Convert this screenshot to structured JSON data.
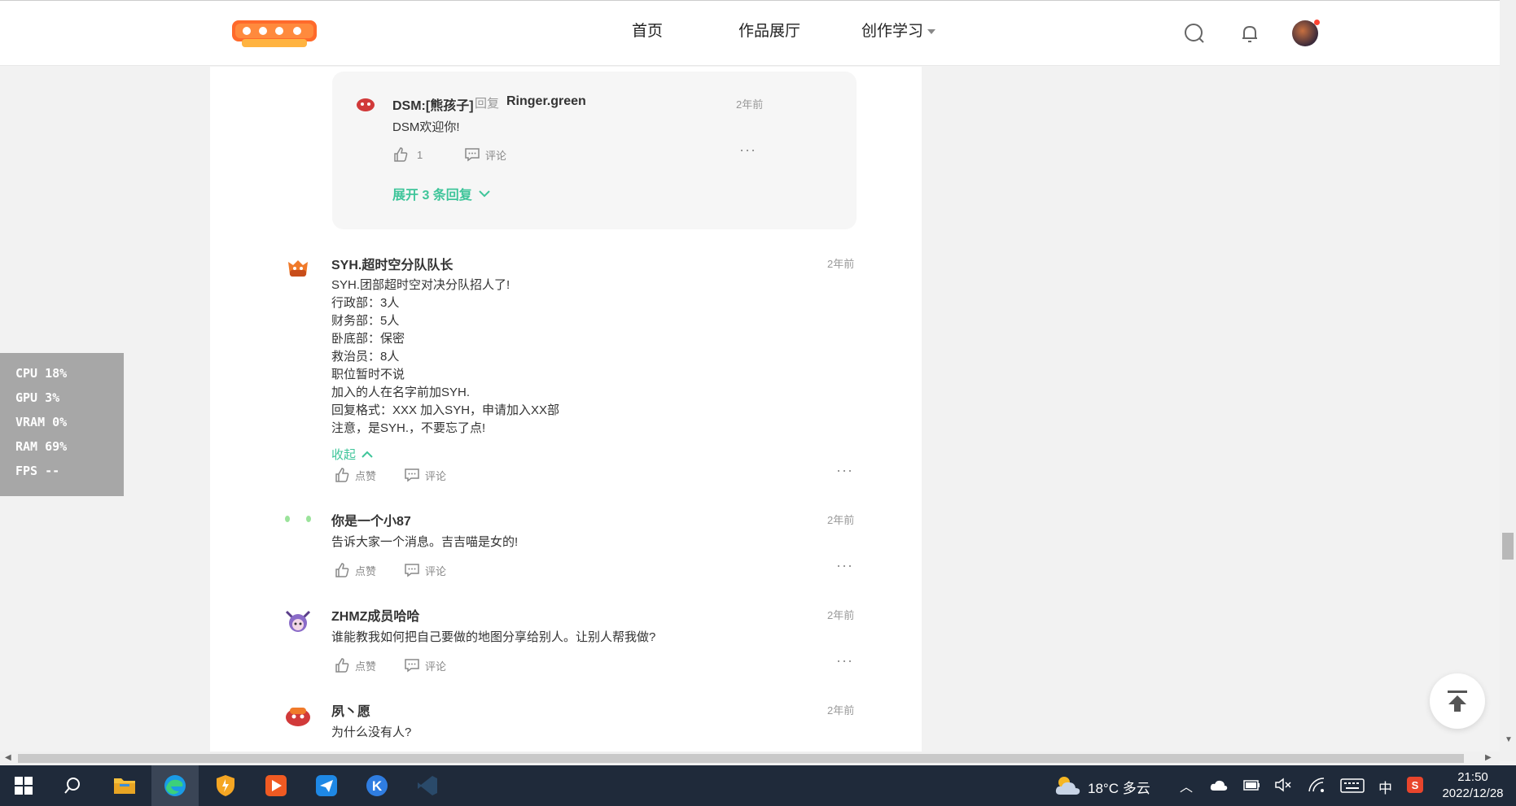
{
  "header": {
    "logo_alt": "神奇代码岛",
    "nav": {
      "home": "首页",
      "gallery": "作品展厅",
      "learn": "创作学习"
    }
  },
  "reply": {
    "user": "DSM:[熊孩子]",
    "reply_word": "回复",
    "target": "Ringer.green",
    "time": "2年前",
    "text": "DSM欢迎你!",
    "likes": "1",
    "comment_label": "评论",
    "expand": "展开 3 条回复"
  },
  "comments": [
    {
      "user": "SYH.超时空分队队长",
      "time": "2年前",
      "lines": [
        "SYH.团部超时空对决分队招人了!",
        "行政部：3人",
        "财务部：5人",
        "卧底部：保密",
        "救治员：8人",
        "职位暂时不说",
        "加入的人在名字前加SYH.",
        "回复格式：XXX 加入SYH，申请加入XX部",
        "注意，是SYH.，不要忘了点!"
      ],
      "collapse": "收起",
      "like_label": "点赞",
      "comment_label": "评论"
    },
    {
      "user": "你是一个小87",
      "time": "2年前",
      "text": "告诉大家一个消息。吉吉喵是女的!",
      "like_label": "点赞",
      "comment_label": "评论"
    },
    {
      "user": "ZHMZ成员哈哈",
      "time": "2年前",
      "text": "谁能教我如何把自己要做的地图分享给别人。让别人帮我做?",
      "like_label": "点赞",
      "comment_label": "评论"
    },
    {
      "user": "夙丶愿",
      "time": "2年前",
      "text": "为什么没有人?"
    }
  ],
  "stats": {
    "cpu": "CPU  18%",
    "gpu": "GPU   3%",
    "vram": "VRAM   0%",
    "ram": "RAM  69%",
    "fps": "FPS --"
  },
  "taskbar": {
    "weather": "18°C  多云",
    "ime": "中",
    "time": "21:50",
    "date": "2022/12/28"
  },
  "colors": {
    "accent": "#3fc59a",
    "taskbar": "#1f2a3a"
  }
}
